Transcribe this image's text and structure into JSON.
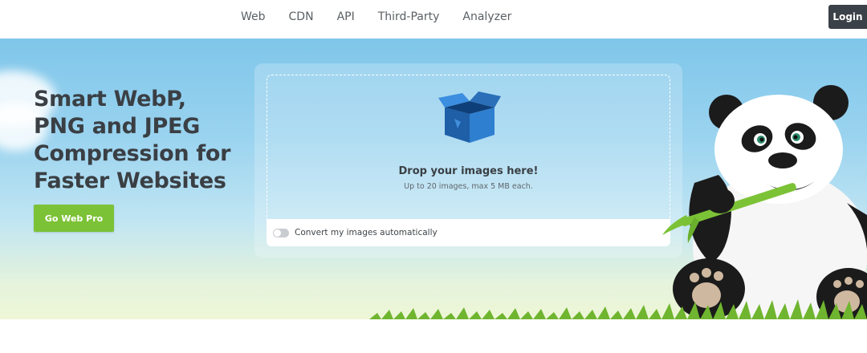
{
  "nav": {
    "items": [
      {
        "label": "Web"
      },
      {
        "label": "CDN"
      },
      {
        "label": "API"
      },
      {
        "label": "Third-Party"
      },
      {
        "label": "Analyzer"
      }
    ],
    "login_label": "Login"
  },
  "hero": {
    "headline": "Smart WebP, PNG and JPEG Compression for Faster Websites",
    "cta_label": "Go Web Pro"
  },
  "dropzone": {
    "title": "Drop your images here!",
    "subtitle": "Up to 20 images, max 5 MB each.",
    "convert_label": "Convert my images automatically",
    "convert_enabled": false
  },
  "icons": {
    "upload": "open-box-icon",
    "mascot": "panda-mascot"
  },
  "colors": {
    "cta_green": "#7cc236",
    "login_dark": "#3b4148",
    "headline_text": "#3a3f44",
    "box_blue": "#2a6fb8"
  }
}
